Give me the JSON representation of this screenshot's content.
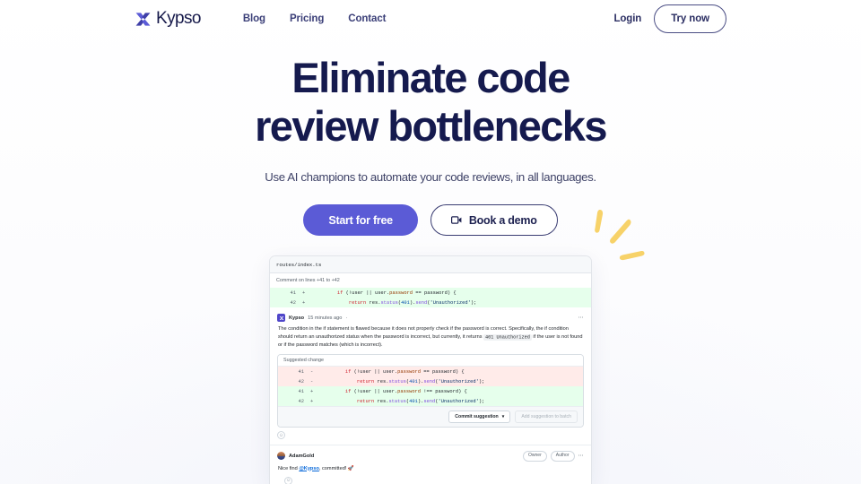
{
  "brand": {
    "name": "Kypso",
    "logo_icon": "kypso-x-logo-icon",
    "accent_color": "#5b5bd6",
    "headline_color": "#151a4e"
  },
  "header": {
    "nav": [
      {
        "label": "Blog"
      },
      {
        "label": "Pricing"
      },
      {
        "label": "Contact"
      }
    ],
    "login_label": "Login",
    "try_now_label": "Try now"
  },
  "hero": {
    "title": "Eliminate code review bottlenecks",
    "subtitle": "Use AI champions to automate your code reviews, in all languages.",
    "primary_cta": "Start for free",
    "secondary_cta": "Book a demo",
    "secondary_cta_icon": "video-camera-icon",
    "sparkle_icon": "sparkle-decoration-icon",
    "sparkle_color": "#f7d269"
  },
  "code_card": {
    "filename": "routes/index.ts",
    "comment_on_lines": "Comment on lines +41 to +42",
    "diff_preview": [
      {
        "line_no": "41",
        "sign": "+",
        "type": "add",
        "tokens": [
          {
            "t": "        ",
            "c": "plain"
          },
          {
            "t": "if",
            "c": "kw"
          },
          {
            "t": " (!user || user.",
            "c": "plain"
          },
          {
            "t": "password",
            "c": "prop"
          },
          {
            "t": " == password) {",
            "c": "plain"
          }
        ]
      },
      {
        "line_no": "42",
        "sign": "+",
        "type": "add",
        "tokens": [
          {
            "t": "            ",
            "c": "plain"
          },
          {
            "t": "return",
            "c": "kw"
          },
          {
            "t": " res.",
            "c": "plain"
          },
          {
            "t": "status",
            "c": "fn"
          },
          {
            "t": "(",
            "c": "plain"
          },
          {
            "t": "401",
            "c": "num"
          },
          {
            "t": ").",
            "c": "plain"
          },
          {
            "t": "send",
            "c": "fn"
          },
          {
            "t": "(",
            "c": "plain"
          },
          {
            "t": "'Unauthorized'",
            "c": "str"
          },
          {
            "t": ");",
            "c": "plain"
          }
        ]
      }
    ],
    "kypso_comment": {
      "avatar_icon": "kypso-avatar-icon",
      "author": "Kypso",
      "timestamp": "15 minutes ago",
      "meta_separator": "·",
      "menu_icon": "kebab-menu-icon",
      "body_part_1": "The condition in the if statement is flawed because it does not properly check if the password is correct. Specifically, the if condition should return an unauthorized status when the password is incorrect, but currently, it returns ",
      "body_code": "401 Unauthorized",
      "body_part_2": " if the user is not found or if the password matches (which is incorrect)."
    },
    "suggestion": {
      "title": "Suggested change",
      "lines": [
        {
          "line_no": "41",
          "sign": "-",
          "type": "del",
          "tokens": [
            {
              "t": "        ",
              "c": "plain"
            },
            {
              "t": "if",
              "c": "kw"
            },
            {
              "t": " (!user || user.",
              "c": "plain"
            },
            {
              "t": "password",
              "c": "prop"
            },
            {
              "t": " == password) {",
              "c": "plain"
            }
          ]
        },
        {
          "line_no": "42",
          "sign": "-",
          "type": "del",
          "tokens": [
            {
              "t": "            ",
              "c": "plain"
            },
            {
              "t": "return",
              "c": "kw"
            },
            {
              "t": " res.",
              "c": "plain"
            },
            {
              "t": "status",
              "c": "fn"
            },
            {
              "t": "(",
              "c": "plain"
            },
            {
              "t": "401",
              "c": "num"
            },
            {
              "t": ").",
              "c": "plain"
            },
            {
              "t": "send",
              "c": "fn"
            },
            {
              "t": "(",
              "c": "plain"
            },
            {
              "t": "'Unauthorized'",
              "c": "str"
            },
            {
              "t": ");",
              "c": "plain"
            }
          ]
        },
        {
          "line_no": "41",
          "sign": "+",
          "type": "add",
          "tokens": [
            {
              "t": "        ",
              "c": "plain"
            },
            {
              "t": "if",
              "c": "kw"
            },
            {
              "t": " (!user || user.",
              "c": "plain"
            },
            {
              "t": "password",
              "c": "prop"
            },
            {
              "t": " !== password) {",
              "c": "plain"
            }
          ]
        },
        {
          "line_no": "42",
          "sign": "+",
          "type": "add",
          "tokens": [
            {
              "t": "            ",
              "c": "plain"
            },
            {
              "t": "return",
              "c": "kw"
            },
            {
              "t": " res.",
              "c": "plain"
            },
            {
              "t": "status",
              "c": "fn"
            },
            {
              "t": "(",
              "c": "plain"
            },
            {
              "t": "401",
              "c": "num"
            },
            {
              "t": ").",
              "c": "plain"
            },
            {
              "t": "send",
              "c": "fn"
            },
            {
              "t": "(",
              "c": "plain"
            },
            {
              "t": "'Unauthorized'",
              "c": "str"
            },
            {
              "t": ");",
              "c": "plain"
            }
          ]
        }
      ],
      "commit_label": "Commit suggestion",
      "commit_caret": "▾",
      "batch_label": "Add suggestion to batch"
    },
    "reaction_icon": "emoji-reaction-icon",
    "adam_comment": {
      "avatar_icon": "adamgold-avatar-icon",
      "author": "AdamGold",
      "badges": [
        "Owner",
        "Author"
      ],
      "menu_icon": "kebab-menu-icon",
      "body_prefix": "Nice find ",
      "mention": "@Kypso",
      "body_suffix": ", committed! 🚀"
    }
  }
}
